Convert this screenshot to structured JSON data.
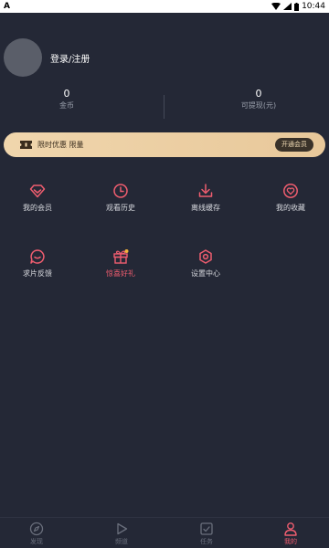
{
  "status_bar": {
    "left_glyph": "A",
    "time": "10:44"
  },
  "profile": {
    "login_text": "登录/注册"
  },
  "stats": [
    {
      "value": "0",
      "label": "金币"
    },
    {
      "value": "0",
      "label": "可提现(元)"
    }
  ],
  "vip_banner": {
    "text": "限时优惠 限量",
    "button": "开通会员"
  },
  "menu": [
    {
      "label": "我的会员",
      "icon": "diamond-icon"
    },
    {
      "label": "观看历史",
      "icon": "clock-icon"
    },
    {
      "label": "离线缓存",
      "icon": "download-icon"
    },
    {
      "label": "我的收藏",
      "icon": "heart-icon"
    },
    {
      "label": "求片反馈",
      "icon": "chat-icon"
    },
    {
      "label": "惊喜好礼",
      "icon": "gift-icon"
    },
    {
      "label": "设置中心",
      "icon": "gear-icon"
    }
  ],
  "tabs": [
    {
      "label": "发现",
      "icon": "compass-icon"
    },
    {
      "label": "频道",
      "icon": "play-icon"
    },
    {
      "label": "任务",
      "icon": "task-icon"
    },
    {
      "label": "我的",
      "icon": "user-icon"
    }
  ],
  "colors": {
    "background": "#242836",
    "accent": "#ef5d6f",
    "banner_gold": "#f0d6ad"
  }
}
